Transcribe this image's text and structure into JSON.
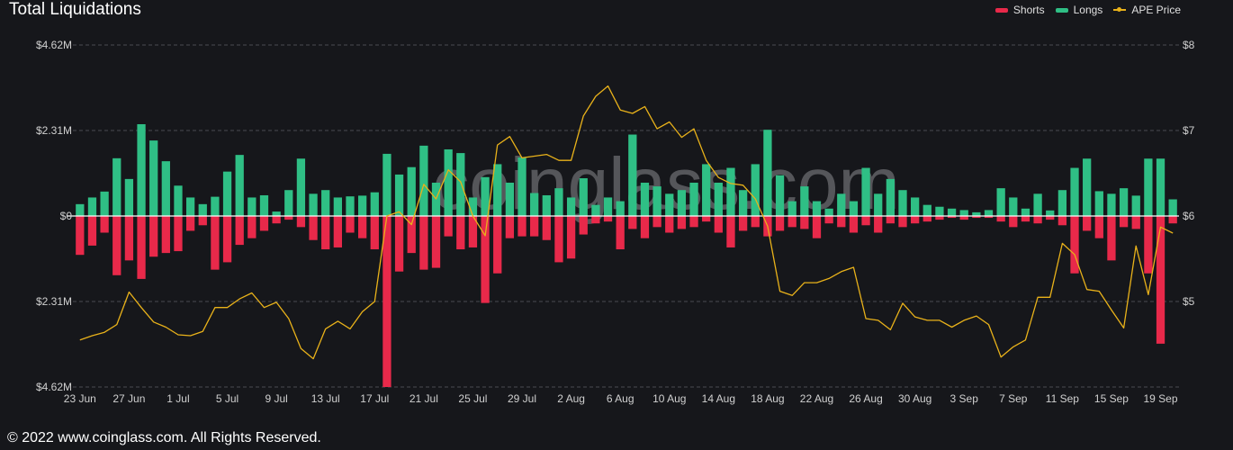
{
  "header": {
    "title": "Total Liquidations"
  },
  "footer": {
    "copyright": "© 2022 www.coinglass.com. All Rights Reserved."
  },
  "watermark": "coinglass.com",
  "colors": {
    "shorts": "#e8294a",
    "longs": "#2fbf85",
    "price": "#e9b21a",
    "background": "#16171b",
    "grid": "#4a4b50",
    "zero": "#ffffff"
  },
  "chart_data": {
    "type": "bar",
    "title": "Total Liquidations",
    "legend": [
      {
        "name": "Shorts",
        "kind": "bar"
      },
      {
        "name": "Longs",
        "kind": "bar"
      },
      {
        "name": "APE Price",
        "kind": "line"
      }
    ],
    "legend_position": "top-right",
    "y_left": {
      "ticks": [
        "$4.62M",
        "$2.31M",
        "$0",
        "$2.31M",
        "$4.62M"
      ],
      "range_millions": [
        -4.62,
        4.62
      ]
    },
    "y_right": {
      "ticks": [
        "$8",
        "$7",
        "$6",
        "$5"
      ],
      "range": [
        4,
        8
      ]
    },
    "x_tick_labels": [
      "23 Jun",
      "27 Jun",
      "1 Jul",
      "5 Jul",
      "9 Jul",
      "13 Jul",
      "17 Jul",
      "21 Jul",
      "25 Jul",
      "29 Jul",
      "2 Aug",
      "6 Aug",
      "10 Aug",
      "14 Aug",
      "18 Aug",
      "22 Aug",
      "26 Aug",
      "30 Aug",
      "3 Sep",
      "7 Sep",
      "11 Sep",
      "15 Sep",
      "19 Sep"
    ],
    "grid": true,
    "units": "USD millions (bars), USD (price)",
    "start_date": "23 Jun",
    "series": [
      {
        "name": "Longs",
        "values": [
          0.32,
          0.5,
          0.66,
          1.56,
          1.0,
          2.48,
          2.04,
          1.48,
          0.82,
          0.5,
          0.32,
          0.52,
          1.2,
          1.65,
          0.5,
          0.56,
          0.12,
          0.7,
          1.55,
          0.6,
          0.7,
          0.5,
          0.53,
          0.55,
          0.64,
          1.68,
          1.12,
          1.32,
          1.9,
          0.9,
          1.8,
          1.7,
          0.5,
          1.05,
          1.4,
          0.9,
          1.58,
          0.62,
          0.56,
          0.75,
          0.5,
          1.02,
          0.3,
          0.5,
          0.4,
          2.2,
          0.9,
          0.8,
          0.6,
          0.7,
          0.9,
          1.4,
          0.9,
          1.3,
          0.7,
          1.4,
          2.33,
          1.1,
          0.4,
          0.8,
          0.4,
          0.2,
          0.6,
          0.4,
          1.3,
          0.6,
          1.0,
          0.7,
          0.5,
          0.3,
          0.25,
          0.2,
          0.16,
          0.1,
          0.16,
          0.75,
          0.5,
          0.2,
          0.6,
          0.15,
          0.7,
          1.3,
          1.55,
          0.67,
          0.6,
          0.75,
          0.55,
          1.55,
          1.55,
          0.45
        ]
      },
      {
        "name": "Shorts",
        "values": [
          -1.05,
          -0.8,
          -0.45,
          -1.6,
          -1.2,
          -1.7,
          -1.1,
          -1.0,
          -0.95,
          -0.4,
          -0.25,
          -1.45,
          -1.25,
          -0.78,
          -0.6,
          -0.4,
          -0.2,
          -0.1,
          -0.3,
          -0.65,
          -0.9,
          -0.85,
          -0.45,
          -0.6,
          -0.9,
          -4.62,
          -1.5,
          -1.0,
          -1.45,
          -1.4,
          -0.55,
          -0.9,
          -0.85,
          -2.35,
          -1.55,
          -0.6,
          -0.55,
          -0.55,
          -0.65,
          -1.25,
          -1.15,
          -0.5,
          -0.2,
          -0.15,
          -0.9,
          -0.35,
          -0.6,
          -0.3,
          -0.45,
          -0.35,
          -0.3,
          -0.15,
          -0.45,
          -0.85,
          -0.4,
          -0.3,
          -0.55,
          -0.4,
          -0.3,
          -0.35,
          -0.6,
          -0.2,
          -0.3,
          -0.45,
          -0.25,
          -0.45,
          -0.2,
          -0.3,
          -0.2,
          -0.15,
          -0.1,
          -0.05,
          -0.1,
          -0.05,
          -0.05,
          -0.15,
          -0.3,
          -0.15,
          -0.2,
          -0.1,
          -0.25,
          -1.55,
          -0.4,
          -0.6,
          -1.2,
          -0.3,
          -0.35,
          -1.55,
          -3.45,
          -0.2
        ]
      },
      {
        "name": "APE Price",
        "values": [
          4.55,
          4.6,
          4.64,
          4.73,
          5.11,
          4.93,
          4.76,
          4.7,
          4.61,
          4.6,
          4.65,
          4.93,
          4.93,
          5.03,
          5.1,
          4.93,
          4.99,
          4.8,
          4.45,
          4.33,
          4.68,
          4.77,
          4.68,
          4.88,
          5.0,
          6.0,
          6.05,
          5.9,
          6.37,
          6.2,
          6.54,
          6.4,
          6.0,
          5.77,
          6.83,
          6.93,
          6.68,
          6.7,
          6.72,
          6.65,
          6.65,
          7.17,
          7.4,
          7.52,
          7.24,
          7.2,
          7.28,
          7.02,
          7.1,
          6.92,
          7.02,
          6.65,
          6.45,
          6.38,
          6.36,
          6.2,
          5.88,
          5.12,
          5.07,
          5.22,
          5.22,
          5.27,
          5.35,
          5.4,
          4.8,
          4.78,
          4.67,
          4.98,
          4.82,
          4.78,
          4.78,
          4.7,
          4.78,
          4.83,
          4.73,
          4.35,
          4.47,
          4.55,
          5.05,
          5.05,
          5.68,
          5.55,
          5.14,
          5.12,
          4.9,
          4.69,
          5.65,
          5.08,
          5.87,
          5.8
        ]
      }
    ]
  }
}
